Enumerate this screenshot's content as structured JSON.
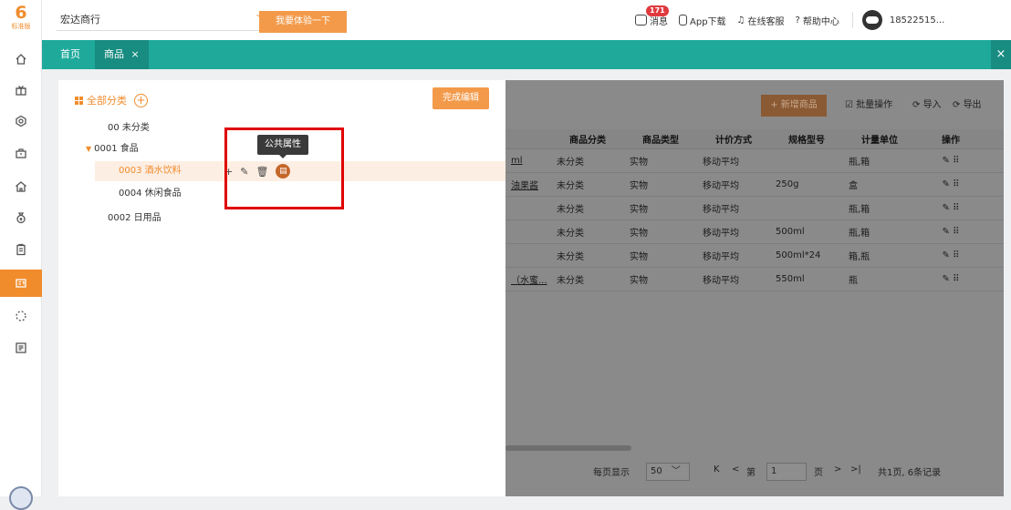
{
  "logo": {
    "mark": "6",
    "sub": "标准版"
  },
  "sidebar": {
    "icons": [
      "home-icon",
      "gift-icon",
      "settings-icon",
      "bag-icon",
      "store-icon",
      "money-bag-icon",
      "clipboard-icon",
      "goods-icon",
      "loading-icon",
      "news-icon"
    ]
  },
  "topbar": {
    "company": "宏达商行",
    "try_button": "我要体验一下",
    "message_label": "消息",
    "message_badge": "171",
    "app_download": "App下载",
    "online_service": "在线客服",
    "help_center": "帮助中心",
    "user": "18522515..."
  },
  "tabs": {
    "home": "首页",
    "goods": "商品",
    "close": "×",
    "side_close": "×"
  },
  "category": {
    "header": "全部分类",
    "finish_button": "完成编辑",
    "tooltip": "公共属性",
    "nodes": [
      "00 未分类",
      "0001 食品",
      "0003 酒水饮料",
      "0004 休闲食品",
      "0002 日用品"
    ],
    "actions": {
      "add": "+",
      "edit": "✎",
      "delete": "🗑",
      "property": "▤"
    }
  },
  "goods": {
    "add_button": "+ 新增商品",
    "batch": "批量操作",
    "import": "导入",
    "export": "导出",
    "columns": [
      "",
      "商品分类",
      "商品类型",
      "计价方式",
      "规格型号",
      "计量单位",
      "操作"
    ],
    "rows": [
      [
        "ml",
        "未分类",
        "实物",
        "移动平均",
        "",
        "瓶,箱",
        "✎ ⠿"
      ],
      [
        "油果酱",
        "未分类",
        "实物",
        "移动平均",
        "250g",
        "盒",
        "✎ ⠿"
      ],
      [
        "",
        "未分类",
        "实物",
        "移动平均",
        "",
        "瓶,箱",
        "✎ ⠿"
      ],
      [
        "",
        "未分类",
        "实物",
        "移动平均",
        "500ml",
        "瓶,箱",
        "✎ ⠿"
      ],
      [
        "",
        "未分类",
        "实物",
        "移动平均",
        "500ml*24",
        "箱,瓶",
        "✎ ⠿"
      ],
      [
        "（水蜜...",
        "未分类",
        "实物",
        "移动平均",
        "550ml",
        "瓶",
        "✎ ⠿"
      ]
    ],
    "pager": {
      "per_page_label": "每页显示",
      "per_page": "50",
      "page_prefix": "第",
      "page": "1",
      "page_suffix": "页",
      "summary": "共1页, 6条记录"
    }
  }
}
